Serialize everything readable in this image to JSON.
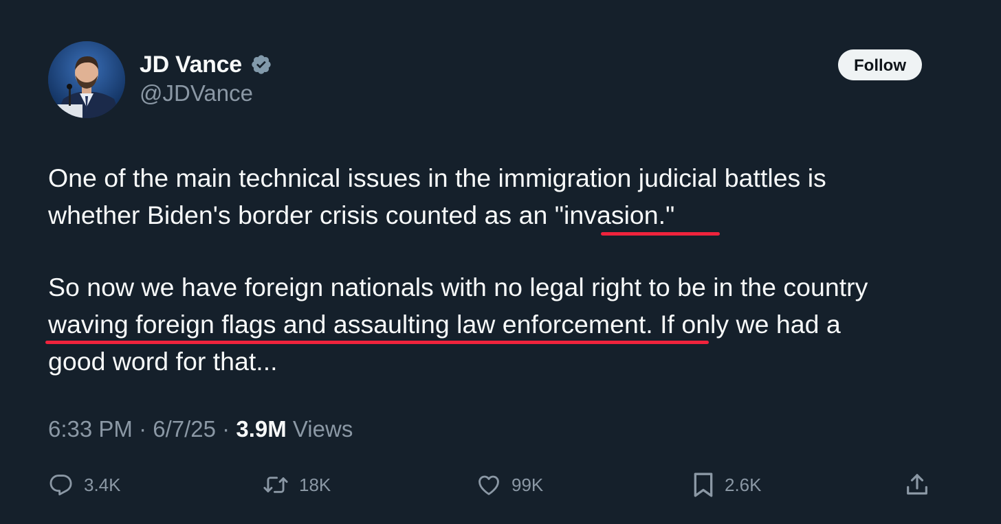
{
  "author": {
    "display_name": "JD Vance",
    "handle": "@JDVance",
    "verified_icon": "verified-badge-icon",
    "avatar": "avatar-photo"
  },
  "follow_label": "Follow",
  "tweet": {
    "para1_a": "One of the main technical issues in the immigration judicial battles is",
    "para1_b": "whether Biden's border crisis counted as an \"invasion.\"",
    "para2_a": "So now we have foreign nationals with no legal right to be in the country",
    "para2_b": "waving foreign flags and assaulting law enforcement. If only we had a",
    "para2_c": "good word for that..."
  },
  "meta": {
    "time": "6:33 PM",
    "date": "6/7/25",
    "views_count": "3.9M",
    "views_label": "Views",
    "separator": "·"
  },
  "actions": {
    "replies": "3.4K",
    "reposts": "18K",
    "likes": "99K",
    "bookmarks": "2.6K"
  },
  "colors": {
    "background": "#15202b",
    "text": "#f7f9f9",
    "muted": "#8b98a5",
    "annotation": "#ef233c",
    "verified": "#829aab"
  }
}
